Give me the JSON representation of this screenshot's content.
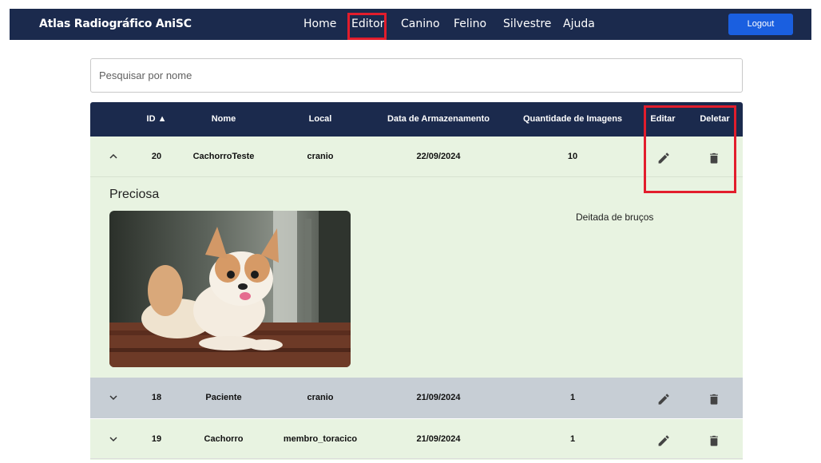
{
  "navbar": {
    "brand": "Atlas Radiográfico AniSC",
    "links": [
      "Home",
      "Editor",
      "Canino",
      "Felino",
      "Silvestre",
      "Ajuda"
    ],
    "active": "Editor",
    "logout_label": "Logout",
    "colors": {
      "bar": "#1b2a4d",
      "logout": "#1a5fe0",
      "highlight": "#e21d2c"
    }
  },
  "search": {
    "placeholder": "Pesquisar por nome",
    "value": ""
  },
  "table": {
    "headers": {
      "id": "ID ▲",
      "nome": "Nome",
      "local": "Local",
      "data": "Data de Armazenamento",
      "quantidade": "Quantidade de Imagens",
      "editar": "Editar",
      "deletar": "Deletar"
    },
    "rows": [
      {
        "id": "20",
        "nome": "CachorroTeste",
        "local": "cranio",
        "data": "22/09/2024",
        "quantidade": "10",
        "expanded": true,
        "chevron": "^"
      },
      {
        "id": "18",
        "nome": "Paciente",
        "local": "cranio",
        "data": "21/09/2024",
        "quantidade": "1",
        "expanded": false,
        "chevron": "v"
      },
      {
        "id": "19",
        "nome": "Cachorro",
        "local": "membro_toracico",
        "data": "21/09/2024",
        "quantidade": "1",
        "expanded": false,
        "chevron": "v"
      }
    ],
    "detail": {
      "title": "Preciosa",
      "description": "Deitada de bruços",
      "photo_icon": "dog-photo"
    },
    "icons": {
      "edit": "pencil-icon",
      "delete": "trash-icon"
    },
    "colors": {
      "header": "#1b2a4d",
      "row_green": "#e8f3e1",
      "row_gray": "#c7ced5"
    }
  }
}
